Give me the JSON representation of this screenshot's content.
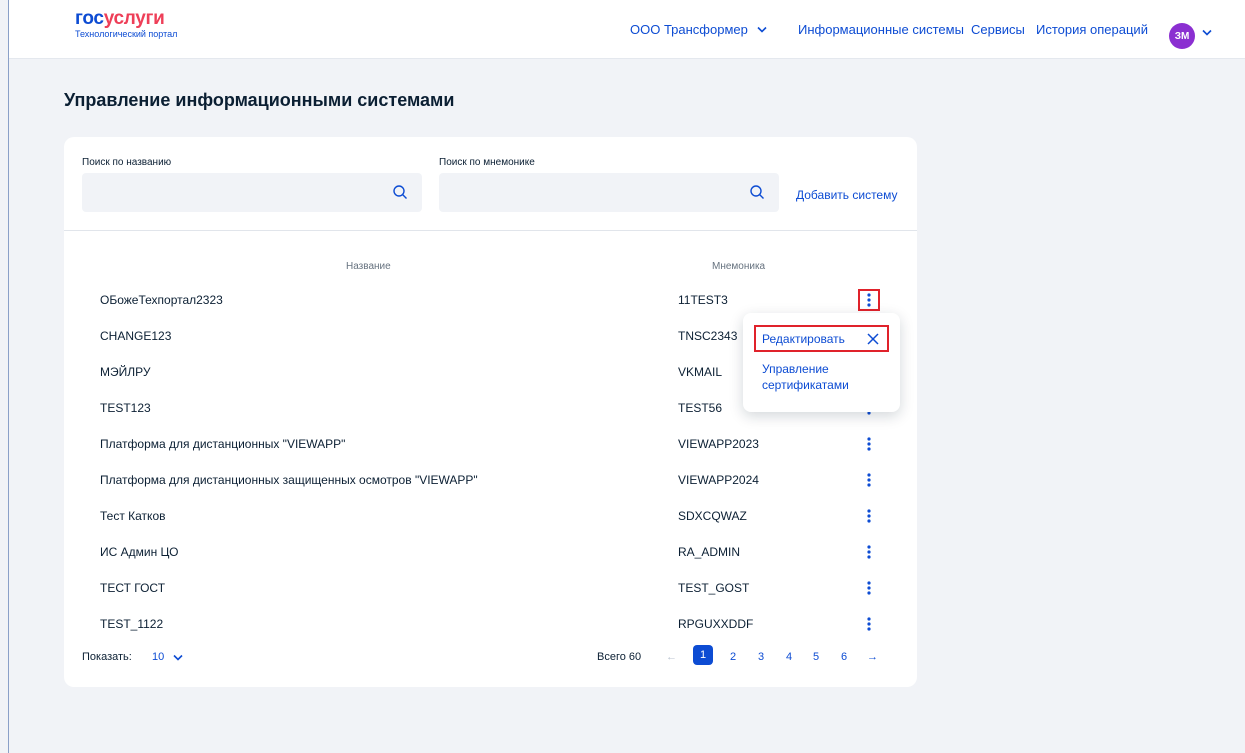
{
  "header": {
    "logo_part1": "гос",
    "logo_part2": "услуги",
    "logo_subtitle": "Технологический портал",
    "org_label": "ООО Трансформер",
    "nav": [
      "Информационные системы",
      "Сервисы",
      "История операций"
    ],
    "avatar_initials": "ЗМ"
  },
  "page": {
    "title": "Управление информационными системами"
  },
  "filters": {
    "name_label": "Поиск по названию",
    "name_value": "",
    "mnemonic_label": "Поиск по мнемонике",
    "mnemonic_value": "",
    "add_system_label": "Добавить систему"
  },
  "table": {
    "columns": [
      "Название",
      "Мнемоника"
    ],
    "rows": [
      {
        "name": "ОБожеТехпортал2323",
        "mnemonic": "11TEST3"
      },
      {
        "name": "CHANGE123",
        "mnemonic": "TNSC2343"
      },
      {
        "name": "МЭЙЛРУ",
        "mnemonic": "VKMAIL"
      },
      {
        "name": "TEST123",
        "mnemonic": "TEST56"
      },
      {
        "name": "Платформа для дистанционных \"VIEWAPP\"",
        "mnemonic": "VIEWAPP2023"
      },
      {
        "name": "Платформа для дистанционных защищенных осмотров \"VIEWAPP\"",
        "mnemonic": "VIEWAPP2024"
      },
      {
        "name": "Тест Катков",
        "mnemonic": "SDXCQWAZ"
      },
      {
        "name": "ИС Админ ЦО",
        "mnemonic": "RA_ADMIN"
      },
      {
        "name": "ТЕСТ ГОСТ",
        "mnemonic": "TEST_GOST"
      },
      {
        "name": "TEST_1122",
        "mnemonic": "RPGUXXDDF"
      }
    ]
  },
  "row_menu": {
    "edit_label": "Редактировать",
    "certs_label": "Управление сертификатами"
  },
  "pagination": {
    "show_label": "Показать:",
    "page_size": "10",
    "total_label": "Всего 60",
    "prev": "←",
    "pages": [
      "1",
      "2",
      "3",
      "4",
      "5",
      "6"
    ],
    "current_page": "1",
    "next": "→"
  },
  "colors": {
    "primary": "#0d4cd3",
    "logo_red": "#ee3f58",
    "highlight": "#e0222b",
    "avatar": "#8b2fd1"
  }
}
